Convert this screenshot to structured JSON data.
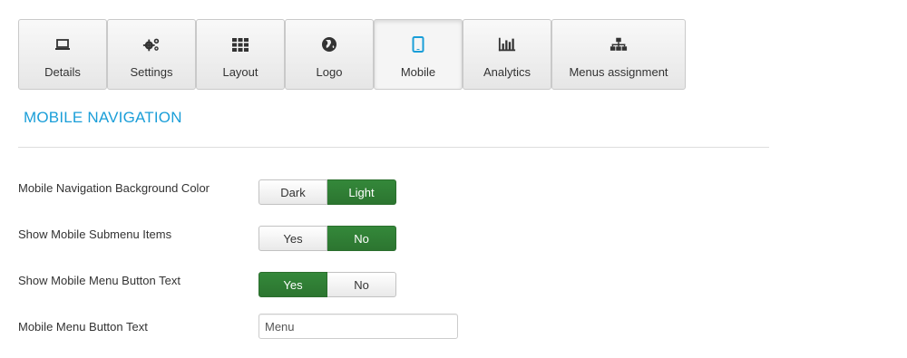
{
  "tabs": [
    {
      "label": "Details",
      "icon": "laptop-icon"
    },
    {
      "label": "Settings",
      "icon": "cogs-icon"
    },
    {
      "label": "Layout",
      "icon": "grid-icon"
    },
    {
      "label": "Logo",
      "icon": "globe-icon"
    },
    {
      "label": "Mobile",
      "icon": "tablet-icon",
      "active": true
    },
    {
      "label": "Analytics",
      "icon": "bar-chart-icon"
    },
    {
      "label": "Menus assignment",
      "icon": "sitemap-icon"
    }
  ],
  "section": {
    "title": "MOBILE NAVIGATION"
  },
  "fields": {
    "bg_color": {
      "label": "Mobile Navigation Background Color",
      "options": [
        "Dark",
        "Light"
      ],
      "selected": "Light"
    },
    "submenu": {
      "label": "Show Mobile Submenu Items",
      "options": [
        "Yes",
        "No"
      ],
      "selected": "No"
    },
    "button_text_toggle": {
      "label": "Show Mobile Menu Button Text",
      "options": [
        "Yes",
        "No"
      ],
      "selected": "Yes"
    },
    "button_text": {
      "label": "Mobile Menu Button Text",
      "value": "Menu"
    }
  },
  "colors": {
    "accent": "#1a9ed8",
    "toggle_on": "#2f7d32"
  }
}
